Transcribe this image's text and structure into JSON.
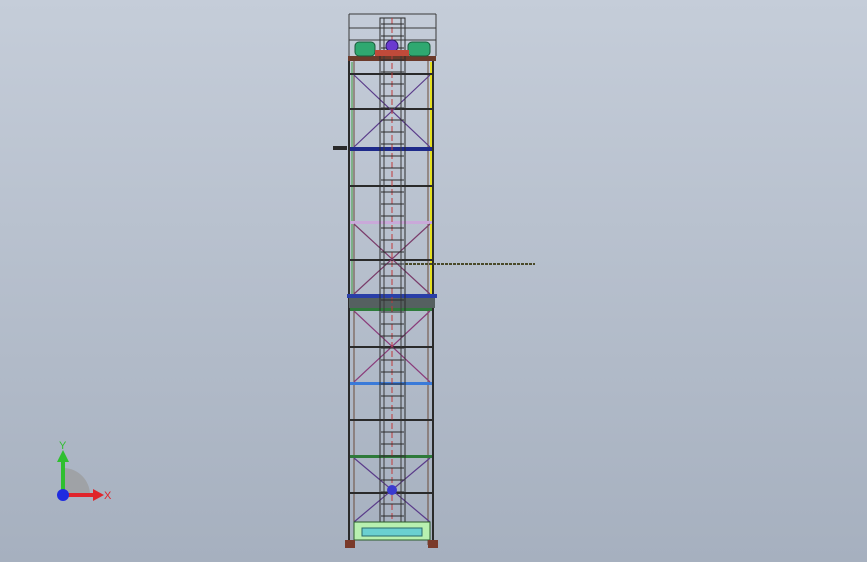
{
  "viewport": {
    "background_top": "#c5cdd9",
    "background_bottom": "#a6b0bf"
  },
  "model": {
    "name": "tower-scaffold-assembly"
  },
  "triad": {
    "x_label": "X",
    "y_label": "Y",
    "x_color": "#e0242b",
    "y_color": "#2fbf2f",
    "z_color": "#1f2be0"
  }
}
